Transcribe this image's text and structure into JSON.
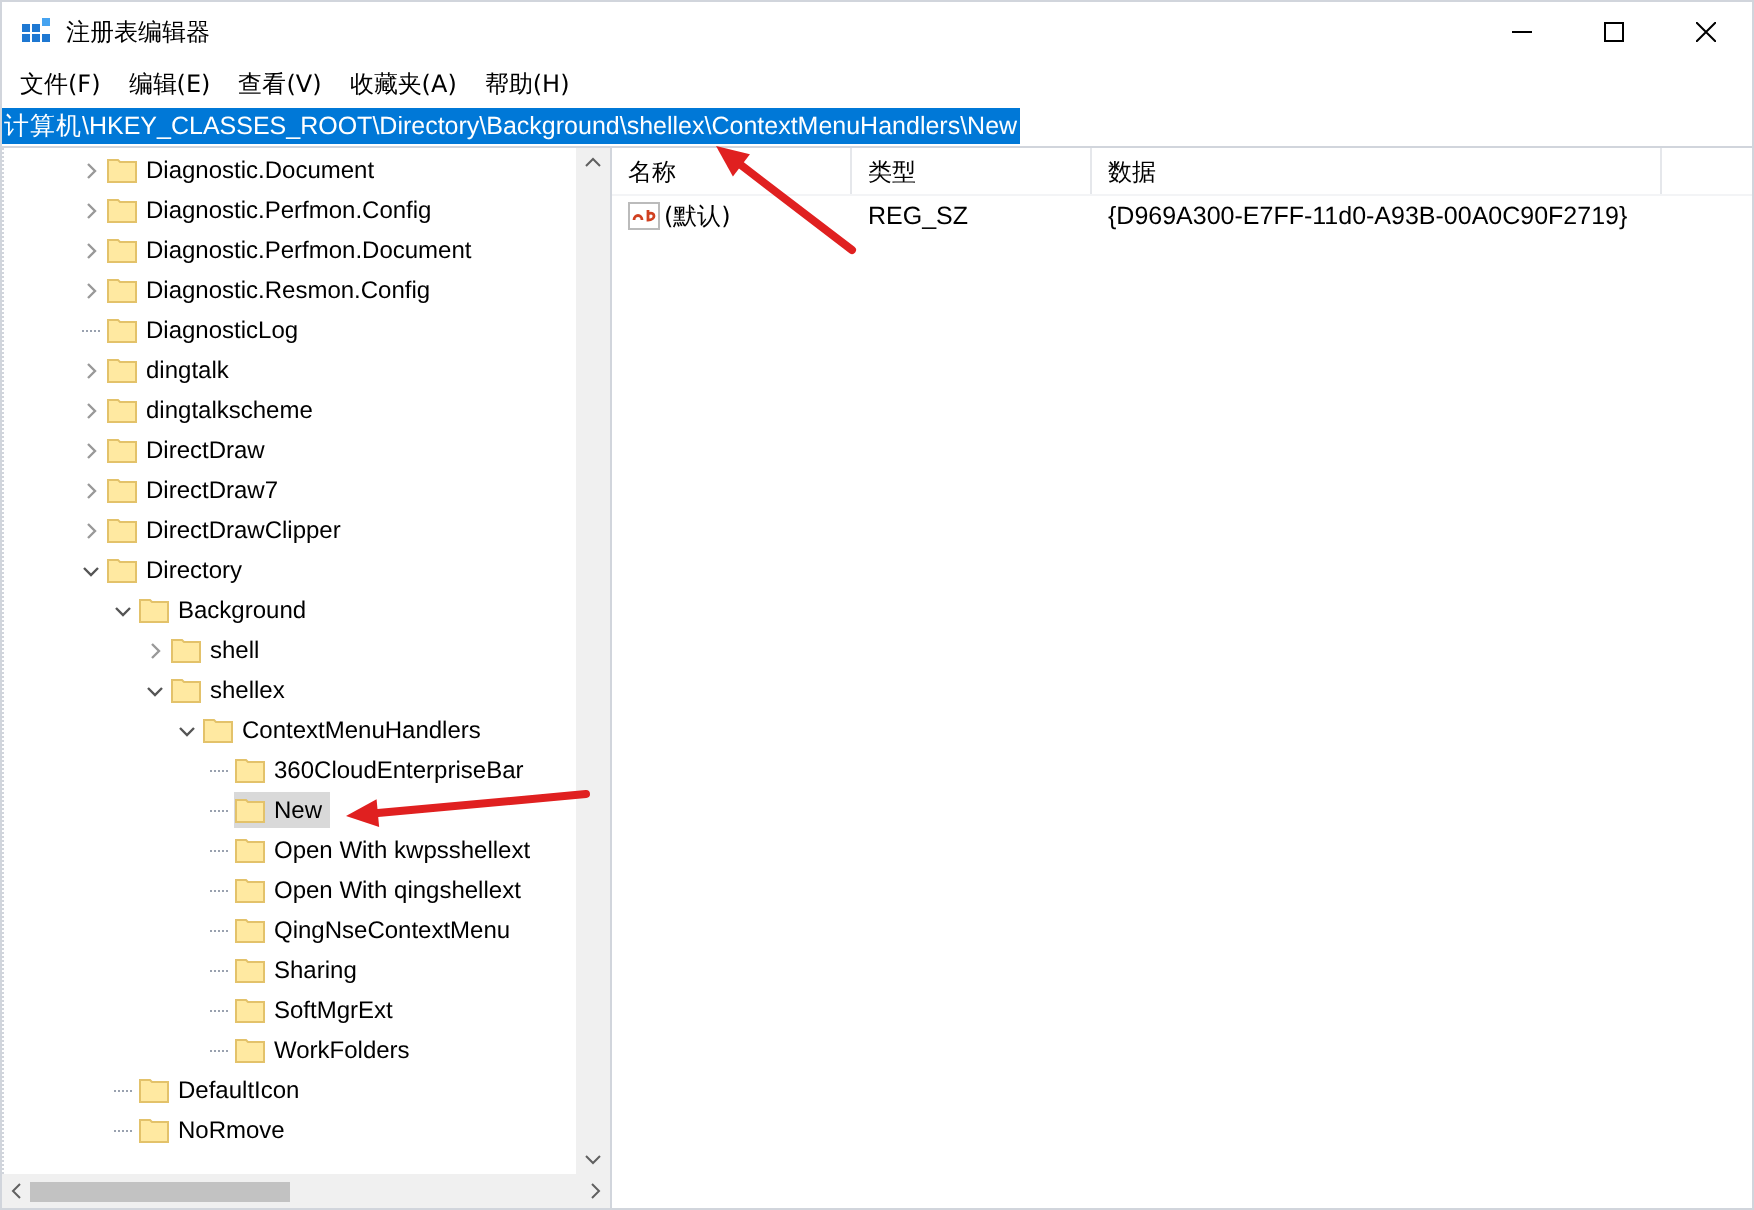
{
  "window": {
    "title": "注册表编辑器"
  },
  "menu": [
    "文件(F)",
    "编辑(E)",
    "查看(V)",
    "收藏夹(A)",
    "帮助(H)"
  ],
  "address": {
    "value": "计算机\\HKEY_CLASSES_ROOT\\Directory\\Background\\shellex\\ContextMenuHandlers\\New",
    "selected": true
  },
  "tree": [
    {
      "label": "Diagnostic.Document",
      "expanded": false,
      "selected": false
    },
    {
      "label": "Diagnostic.Perfmon.Config",
      "expanded": false,
      "selected": false
    },
    {
      "label": "Diagnostic.Perfmon.Document",
      "expanded": false,
      "selected": false
    },
    {
      "label": "Diagnostic.Resmon.Config",
      "expanded": false,
      "selected": false
    },
    {
      "label": "DiagnosticLog",
      "selected": false
    },
    {
      "label": "dingtalk",
      "expanded": false,
      "selected": false
    },
    {
      "label": "dingtalkscheme",
      "expanded": false,
      "selected": false
    },
    {
      "label": "DirectDraw",
      "expanded": false,
      "selected": false
    },
    {
      "label": "DirectDraw7",
      "expanded": false,
      "selected": false
    },
    {
      "label": "DirectDrawClipper",
      "expanded": false,
      "selected": false
    },
    {
      "label": "Directory",
      "expanded": true,
      "selected": false,
      "children": [
        {
          "label": "Background",
          "expanded": true,
          "selected": false,
          "children": [
            {
              "label": "shell",
              "expanded": false,
              "selected": false
            },
            {
              "label": "shellex",
              "expanded": true,
              "selected": false,
              "children": [
                {
                  "label": "ContextMenuHandlers",
                  "expanded": true,
                  "selected": false,
                  "children": [
                    {
                      "label": "360CloudEnterpriseBar",
                      "selected": false
                    },
                    {
                      "label": "New",
                      "selected": true
                    },
                    {
                      "label": "Open With kwpsshellext",
                      "selected": false
                    },
                    {
                      "label": "Open With qingshellext",
                      "selected": false
                    },
                    {
                      "label": "QingNseContextMenu",
                      "selected": false
                    },
                    {
                      "label": "Sharing",
                      "selected": false
                    },
                    {
                      "label": "SoftMgrExt",
                      "selected": false
                    },
                    {
                      "label": "WorkFolders",
                      "selected": false
                    }
                  ]
                }
              ]
            }
          ]
        },
        {
          "label": "DefaultIcon",
          "selected": false
        },
        {
          "label": "NoRmove",
          "selected": false
        }
      ]
    }
  ],
  "values": {
    "columns": [
      "名称",
      "类型",
      "数据"
    ],
    "rows": [
      {
        "name": "(默认)",
        "type": "REG_SZ",
        "data": "{D969A300-E7FF-11d0-A93B-00A0C90F2719}"
      }
    ]
  }
}
